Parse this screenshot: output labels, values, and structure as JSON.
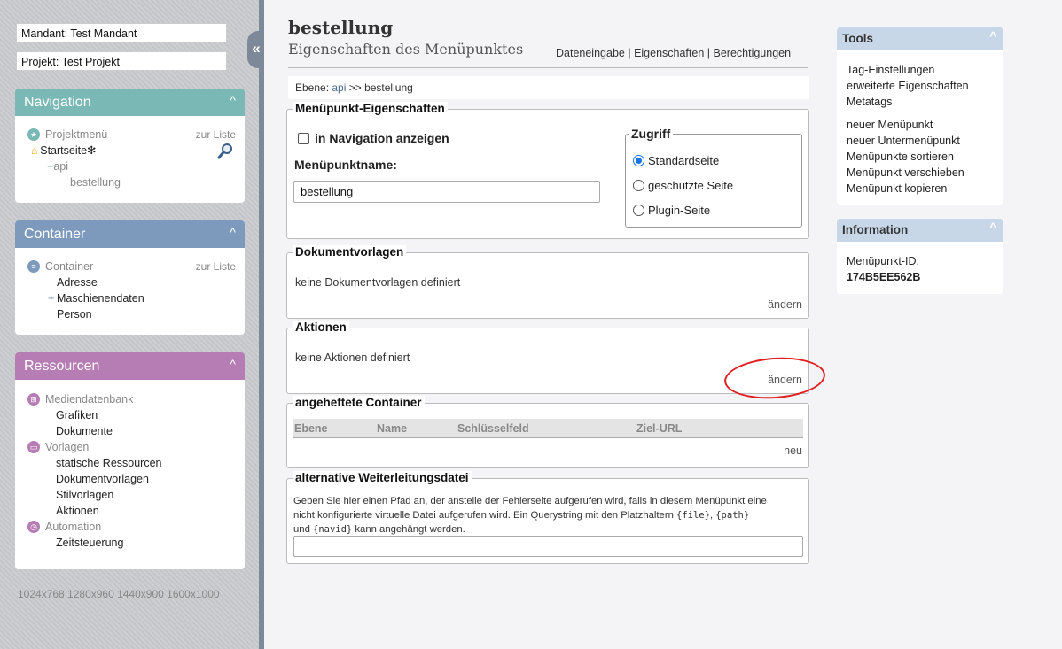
{
  "sidebar": {
    "mandant": "Mandant: Test Mandant",
    "projekt": "Projekt: Test Projekt",
    "collapse_glyph": "«",
    "navigation": {
      "title": "Navigation",
      "chevron": "^",
      "root": "Projektmenü",
      "root_link": "zur Liste",
      "startseite": "Startseite",
      "star": "✻",
      "api_toggle": "−",
      "api": "api",
      "bestellung": "bestellung"
    },
    "container": {
      "title": "Container",
      "chevron": "^",
      "root": "Container",
      "root_link": "zur Liste",
      "items": [
        "Adresse",
        "Maschienendaten",
        "Person"
      ],
      "expand_glyph": "+"
    },
    "ressourcen": {
      "title": "Ressourcen",
      "chevron": "^",
      "mediendatenbank": "Mediendatenbank",
      "medien_items": [
        "Grafiken",
        "Dokumente"
      ],
      "vorlagen": "Vorlagen",
      "vorlagen_items": [
        "statische Ressourcen",
        "Dokumentvorlagen",
        "Stilvorlagen",
        "Aktionen"
      ],
      "automation": "Automation",
      "automation_items": [
        "Zeitsteuerung"
      ]
    },
    "resolutions": "1024x768 1280x960 1440x900 1600x1000"
  },
  "header": {
    "title": "bestellung",
    "subtitle": "Eigenschaften des Menüpunktes",
    "links": [
      "Dateneingabe",
      "Eigenschaften",
      "Berechtigungen"
    ],
    "separator": " | "
  },
  "breadcrumb": {
    "prefix": "Ebene: ",
    "api": "api",
    "sep": " >> ",
    "current": "bestellung"
  },
  "menuepunkt": {
    "legend": "Menüpunkt-Eigenschaften",
    "nav_checkbox_label": "in Navigation anzeigen",
    "name_label": "Menüpunktname:",
    "name_value": "bestellung",
    "access_legend": "Zugriff",
    "access_options": [
      "Standardseite",
      "geschützte Seite",
      "Plugin-Seite"
    ],
    "access_selected": "Standardseite"
  },
  "dokumentvorlagen": {
    "legend": "Dokumentvorlagen",
    "text": "keine Dokumentvorlagen definiert",
    "link": "ändern"
  },
  "aktionen": {
    "legend": "Aktionen",
    "text": "keine Aktionen definiert",
    "link": "ändern"
  },
  "container_section": {
    "legend": "angeheftete Container",
    "columns": [
      "Ebene",
      "Name",
      "Schlüsselfeld",
      "Ziel-URL"
    ],
    "link": "neu"
  },
  "weiterleitung": {
    "legend": "alternative Weiterleitungsdatei",
    "line1": "Geben Sie hier einen Pfad an, der anstelle der Fehlerseite aufgerufen wird, falls in diesem Menüpunkt eine",
    "line2a": "nicht konfigurierte virtuelle Datei aufgerufen wird. Ein Querystring mit den Platzhaltern ",
    "code_file": "{file}",
    "comma": ", ",
    "code_path": "{path}",
    "line3a": "und ",
    "code_navid": "{navid}",
    "line3b": " kann angehängt werden.",
    "value": ""
  },
  "tools": {
    "title": "Tools",
    "chevron": "^",
    "group1": [
      "Tag-Einstellungen",
      "erweiterte Eigenschaften",
      "Metatags"
    ],
    "group2": [
      "neuer Menüpunkt",
      "neuer Untermenüpunkt",
      "Menüpunkte sortieren",
      "Menüpunkt verschieben",
      "Menüpunkt kopieren"
    ]
  },
  "information": {
    "title": "Information",
    "chevron": "^",
    "id_label": "Menüpunkt-ID:",
    "id_value": "174B5EE562B"
  },
  "colors": {
    "navigation": "#7ab8b5",
    "container": "#7d9abd",
    "ressourcen": "#b67cb4",
    "highlight_circle": "#e02020"
  }
}
